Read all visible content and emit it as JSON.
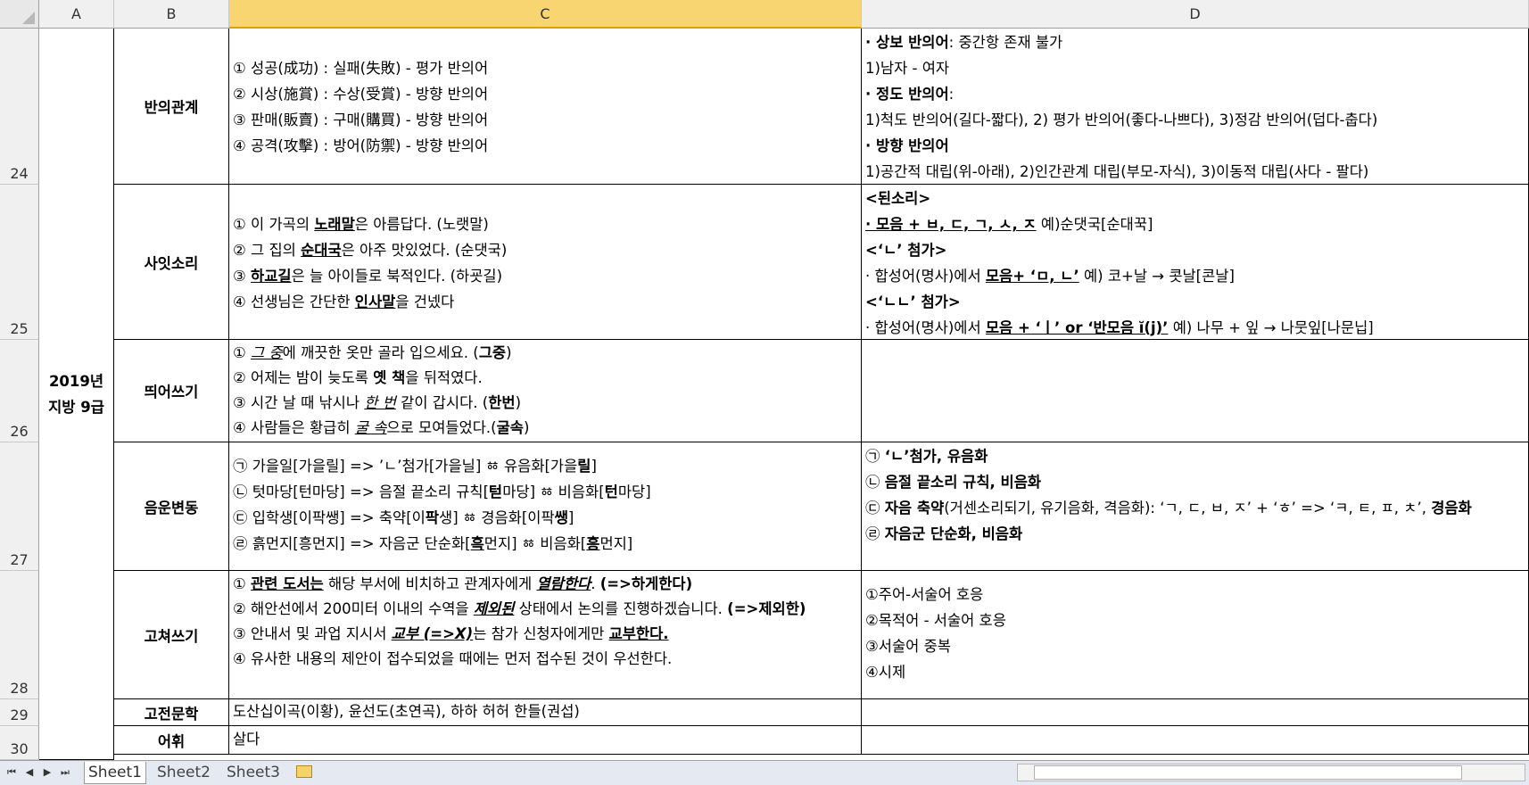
{
  "columns": [
    "A",
    "B",
    "C",
    "D"
  ],
  "rows": [
    "24",
    "25",
    "26",
    "27",
    "28",
    "29",
    "30"
  ],
  "merged_a": [
    "2019년",
    "지방 9급"
  ],
  "r24": {
    "cat": "반의관계",
    "c": [
      "① 성공(成功) : 실패(失敗) - 평가 반의어",
      "② 시상(施賞) : 수상(受賞) - 방향 반의어",
      "③ 판매(販賣) : 구매(購買) - 방향 반의어",
      "④ 공격(攻擊) : 방어(防禦) - 방향 반의어"
    ],
    "d1a": "· 상보 반의어",
    "d1b": ": 중간항 존재 불가",
    "d2": "1)남자 - 여자",
    "d3a": "· 정도 반의어",
    "d3b": ":",
    "d4": "1)척도 반의어(길다-짧다), 2) 평가 반의어(좋다-나쁘다), 3)정감 반의어(덥다-춥다)",
    "d5": "· 방향 반의어",
    "d6": "1)공간적 대립(위-아래), 2)인간관계 대립(부모-자식), 3)이동적 대립(사다 - 팔다)"
  },
  "r25": {
    "cat": "사잇소리",
    "c1": [
      "① 이 가곡의 ",
      "노래말",
      "은 아름답다. (노랫말)"
    ],
    "c2": [
      "② 그 집의 ",
      "순대국",
      "은 아주 맛있었다. (순댓국)"
    ],
    "c3": [
      "③ ",
      "하교길",
      "은 늘 아이들로 북적인다. (하굣길)"
    ],
    "c4": [
      "④ 선생님은 간단한 ",
      "인사말",
      "을 건넸다"
    ],
    "d1": "<된소리>",
    "d2": [
      "· 모음 + ㅂ, ㄷ, ㄱ, ㅅ, ㅈ",
      " 예)순댓국[순대꾹]"
    ],
    "d3": "<‘ㄴ’ 첨가>",
    "d4": [
      "· 합성어(명사)에서 ",
      "모음+ ‘ㅁ, ㄴ’",
      " 예) 코+날 → 콧날[콘날]"
    ],
    "d5": "<‘ㄴㄴ’ 첨가>",
    "d6": [
      "· 합성어(명사)에서 ",
      "모음 + ‘ㅣ’ or ‘반모음 ĭ(j)’",
      " 예) 나무 + 잎 → 나뭇잎[나문닙]"
    ]
  },
  "r26": {
    "cat": "띄어쓰기",
    "c1": [
      "① ",
      "그 중",
      "에 깨끗한 옷만 골라 입으세요. (",
      "그중",
      ")"
    ],
    "c2": [
      "② 어제는 밤이 늦도록 ",
      "옛 책",
      "을 뒤적였다."
    ],
    "c3": [
      "③ 시간 날 때 낚시나 ",
      "한 번",
      " 같이 갑시다. (",
      "한번",
      ")"
    ],
    "c4": [
      "④ 사람들은 황급히 ",
      "굴 속",
      "으로 모여들었다.(",
      "굴속",
      ")"
    ]
  },
  "r27": {
    "cat": "음운변동",
    "c1": [
      "㉠ 가을일[가을릴] => ’ㄴ’첨가[가을닐] ㆅ 유음화[가을",
      "릴",
      "]"
    ],
    "c2": [
      "㉡ 텃마당[턴마당] => 음절 끝소리 규칙[",
      "턷",
      "마당] ㆅ 비음화[",
      "턴",
      "마당]"
    ],
    "c3": [
      "㉢ 입학생[이팍쌩] => 축약[이",
      "팍",
      "생] ㆅ 경음화[이팍",
      "쌩",
      "]"
    ],
    "c4": [
      "㉣ 흙먼지[흥먼지] => 자음군 단순화[",
      "흑",
      "먼지] ㆅ 비음화[",
      "흥",
      "먼지]"
    ],
    "d1": [
      "㉠ ",
      "‘ㄴ’첨가, 유음화"
    ],
    "d2": [
      "㉡ ",
      "음절 끝소리 규칙, 비음화"
    ],
    "d3": [
      "㉢ ",
      "자음 축약",
      "(거센소리되기, 유기음화, 격음화): ‘ㄱ, ㄷ, ㅂ, ㅈ’ + ‘ㅎ’ => ‘ㅋ, ㅌ, ㅍ, ㅊ’, ",
      "경음화"
    ],
    "d4": [
      "㉣ ",
      "자음군 단순화, 비음화"
    ]
  },
  "r28": {
    "cat": "고쳐쓰기",
    "c1": [
      "① ",
      "관련 도서는",
      " 해당 부서에 비치하고 관계자에게 ",
      "열람한다",
      ". ",
      "(=>하게한다)"
    ],
    "c2": [
      "② 해안선에서 200미터 이내의 수역을 ",
      "제외된",
      " 상태에서 논의를 진행하겠습니다. ",
      "(=>제외한)"
    ],
    "c3": [
      "③ 안내서 및 과업 지시서 ",
      "교부 (=>X)",
      "는 참가 신청자에게만 ",
      "교부한다."
    ],
    "c4": "④ 유사한 내용의 제안이 접수되었을 때에는 먼저 접수된 것이 우선한다.",
    "d": [
      "①주어-서술어 호응",
      "②목적어 - 서술어 호응",
      "③서술어 중복",
      "④시제"
    ]
  },
  "r29": {
    "cat": "고전문학",
    "c": "도산십이곡(이황), 윤선도(초연곡), 하하 허허 한들(권섭)"
  },
  "r30": {
    "cat": "어휘",
    "c": "살다"
  },
  "sheets": [
    "Sheet1",
    "Sheet2",
    "Sheet3"
  ],
  "nav": [
    "⏮",
    "◀",
    "▶",
    "⏭"
  ]
}
